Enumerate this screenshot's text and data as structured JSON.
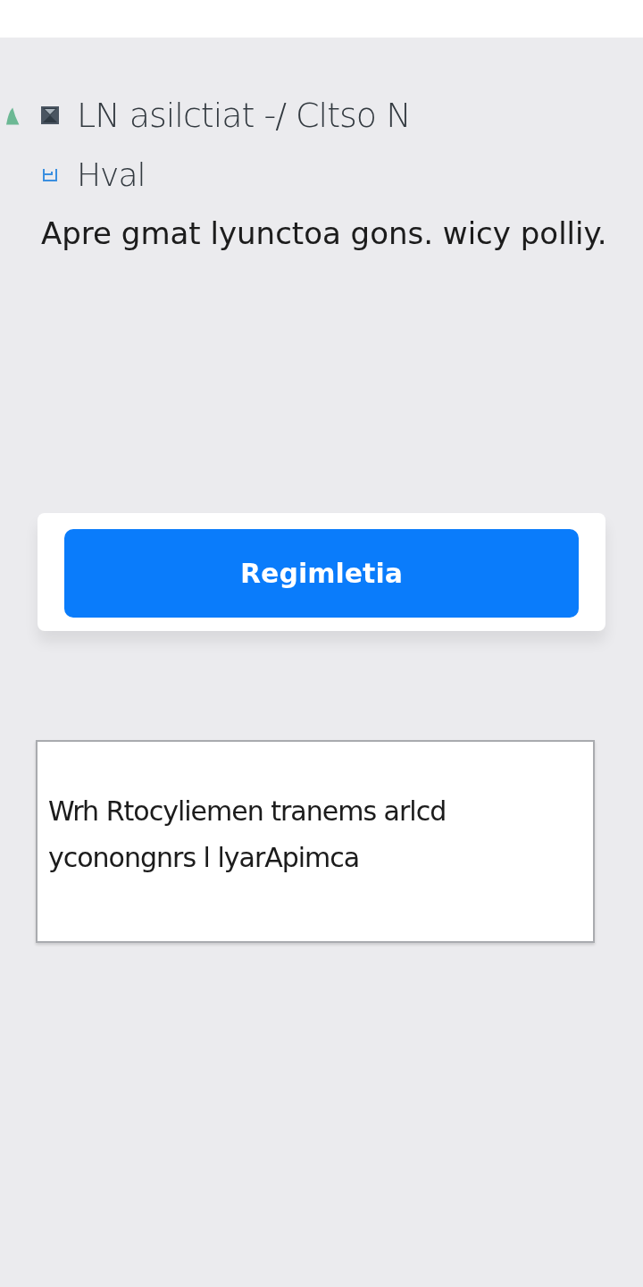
{
  "header_rows": [
    {
      "kind": "dark",
      "label": "LN asilctiat  -/ Cltso N"
    },
    {
      "kind": "blue",
      "label": "Hval"
    }
  ],
  "description": "Apre gmat lyunctoa gons. wicy polliy.",
  "primary_button": {
    "label": "Regimletia"
  },
  "text_box": {
    "value": "Wrh Rtocyliemen tranems arlcd yconongnrs l lyarApimca"
  }
}
